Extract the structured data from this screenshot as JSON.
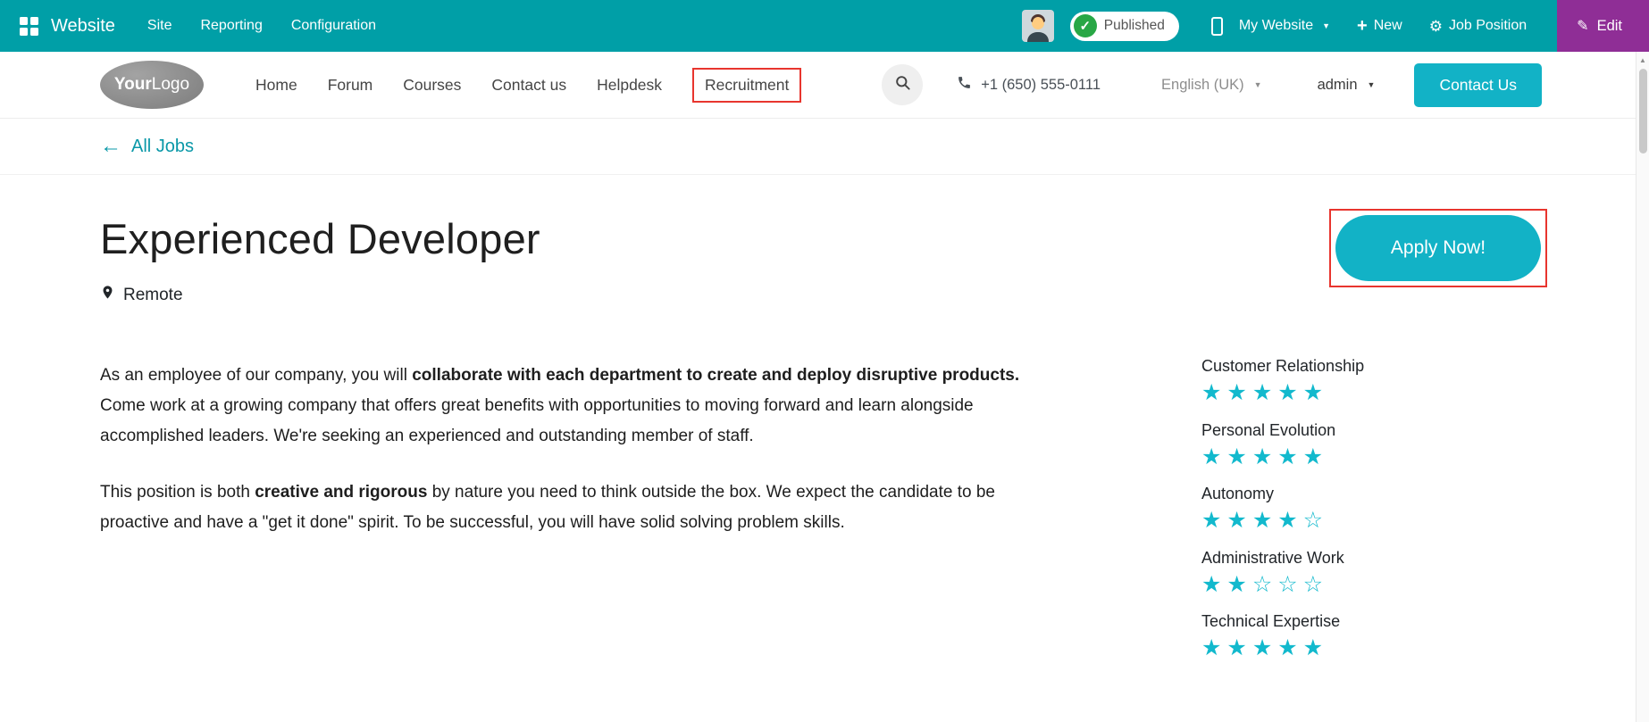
{
  "colors": {
    "topbar_bg": "#009fa7",
    "accent_teal": "#12b2c6",
    "star_teal": "#12b9cd",
    "edit_purple": "#8f2e96",
    "published_green": "#28a745",
    "annotation_red": "#e8352e",
    "link_teal": "#0a98a8"
  },
  "icons": {
    "check": "✓",
    "caret": "▼",
    "plus": "+",
    "gear": "⚙",
    "pencil": "✎",
    "back_arrow": "←",
    "scroll_up": "▲"
  },
  "topbar": {
    "app_name": "Website",
    "menus": [
      "Site",
      "Reporting",
      "Configuration"
    ],
    "published_label": "Published",
    "website_selector": "My Website",
    "new_label": "New",
    "job_position_label": "Job Position",
    "edit_label": "Edit"
  },
  "header": {
    "logo_part1": "Your",
    "logo_part2": "Logo",
    "nav": [
      "Home",
      "Forum",
      "Courses",
      "Contact us",
      "Helpdesk",
      "Recruitment"
    ],
    "phone": "+1 (650) 555-0111",
    "language": "English (UK)",
    "user": "admin",
    "contact_button": "Contact Us"
  },
  "breadcrumb": {
    "back_label": "All Jobs"
  },
  "job": {
    "title": "Experienced Developer",
    "location": "Remote",
    "apply_button": "Apply Now!",
    "p1_before": "As an employee of our company, you will ",
    "p1_bold": "collaborate with each department to create and deploy disruptive products.",
    "p1_after": " Come work at a growing company that offers great benefits with opportunities to moving forward and learn alongside accomplished leaders. We're seeking an experienced and outstanding member of staff.",
    "p2_before": "This position is both ",
    "p2_bold": "creative and rigorous",
    "p2_after": " by nature you need to think outside the box. We expect the candidate to be proactive and have a \"get it done\" spirit. To be successful, you will have solid solving problem skills.",
    "skills": [
      {
        "label": "Customer Relationship",
        "value": 5,
        "max": 5,
        "stars": "★★★★★"
      },
      {
        "label": "Personal Evolution",
        "value": 5,
        "max": 5,
        "stars": "★★★★★"
      },
      {
        "label": "Autonomy",
        "value": 4,
        "max": 5,
        "stars": "★★★★☆"
      },
      {
        "label": "Administrative Work",
        "value": 2,
        "max": 5,
        "stars": "★★☆☆☆"
      },
      {
        "label": "Technical Expertise",
        "value": 5,
        "max": 5,
        "stars": "★★★★★"
      }
    ]
  }
}
